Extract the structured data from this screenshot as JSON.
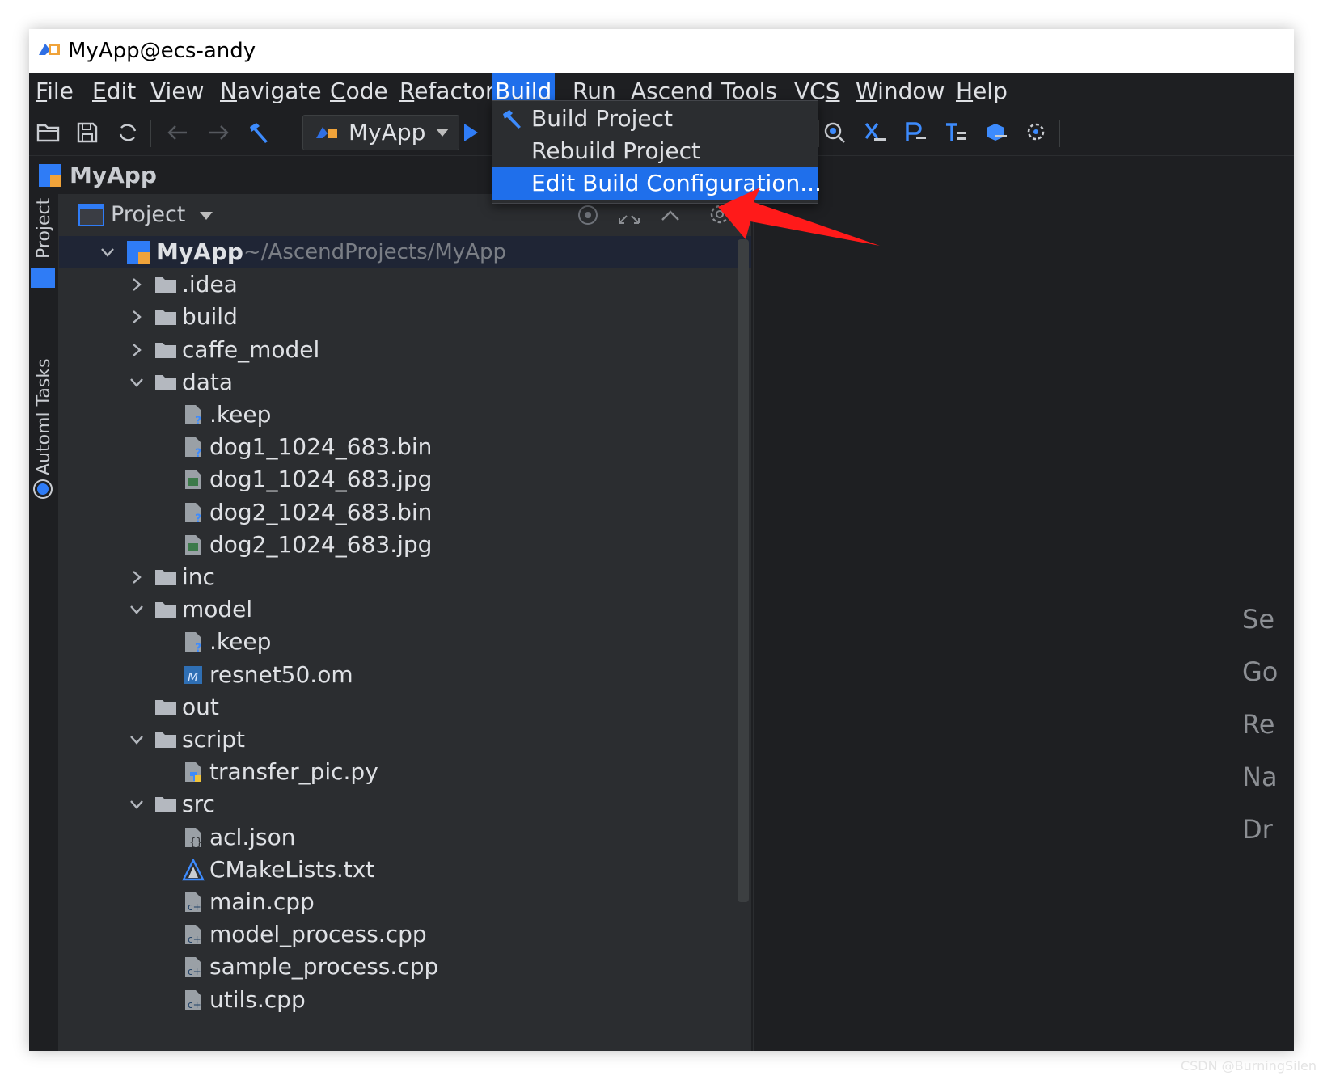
{
  "window": {
    "title": "MyApp@ecs-andy"
  },
  "menubar": {
    "items": [
      {
        "label": "File",
        "key": "F",
        "rest": "ile"
      },
      {
        "label": "Edit",
        "key": "E",
        "rest": "dit"
      },
      {
        "label": "View",
        "key": "V",
        "rest": "iew"
      },
      {
        "label": "Navigate",
        "key": "N",
        "rest": "avigate"
      },
      {
        "label": "Code",
        "key": "C",
        "rest": "ode"
      },
      {
        "label": "Refactor",
        "key": "R",
        "rest": "efactor"
      },
      {
        "label": "Build",
        "key": "B",
        "rest": "uild"
      },
      {
        "label": "Run",
        "pre": "R",
        "key": "u",
        "rest": "n"
      },
      {
        "label": "Ascend",
        "key": "A",
        "rest": "scend"
      },
      {
        "label": "Tools",
        "key": "T",
        "rest": "ools"
      },
      {
        "label": "VCS",
        "pre": "VC",
        "key": "S",
        "rest": ""
      },
      {
        "label": "Window",
        "key": "W",
        "rest": "indow"
      },
      {
        "label": "Help",
        "key": "H",
        "rest": "elp"
      }
    ],
    "active": "Build"
  },
  "toolbar": {
    "run_config": "MyApp",
    "icons": [
      "open-folder-icon",
      "save-icon",
      "sync-icon",
      "back-icon",
      "forward-icon",
      "build-hammer-icon",
      "run-icon",
      "search-model-icon",
      "tool-x-icon",
      "tool-p-icon",
      "tool-t-icon",
      "tool-box-icon",
      "tool-gear-icon"
    ]
  },
  "breadcrumb": {
    "label": "MyApp"
  },
  "side_stripe": {
    "project_tab": "Project",
    "tasks_tab": "Automl Tasks"
  },
  "project_panel": {
    "title": "Project",
    "root": {
      "name": "MyApp",
      "path": "~/AscendProjects/MyApp"
    },
    "nodes": [
      {
        "name": ".idea",
        "type": "folder",
        "depth": 1,
        "state": "collapsed"
      },
      {
        "name": "build",
        "type": "folder",
        "depth": 1,
        "state": "collapsed"
      },
      {
        "name": "caffe_model",
        "type": "folder",
        "depth": 1,
        "state": "collapsed"
      },
      {
        "name": "data",
        "type": "folder",
        "depth": 1,
        "state": "expanded"
      },
      {
        "name": ".keep",
        "type": "unknown-file",
        "depth": 2
      },
      {
        "name": "dog1_1024_683.bin",
        "type": "unknown-file",
        "depth": 2
      },
      {
        "name": "dog1_1024_683.jpg",
        "type": "image-file",
        "depth": 2
      },
      {
        "name": "dog2_1024_683.bin",
        "type": "unknown-file",
        "depth": 2
      },
      {
        "name": "dog2_1024_683.jpg",
        "type": "image-file",
        "depth": 2
      },
      {
        "name": "inc",
        "type": "folder",
        "depth": 1,
        "state": "collapsed"
      },
      {
        "name": "model",
        "type": "folder",
        "depth": 1,
        "state": "expanded"
      },
      {
        "name": ".keep",
        "type": "unknown-file",
        "depth": 2
      },
      {
        "name": "resnet50.om",
        "type": "model-file",
        "depth": 2
      },
      {
        "name": "out",
        "type": "folder",
        "depth": 1,
        "state": "none"
      },
      {
        "name": "script",
        "type": "folder",
        "depth": 1,
        "state": "expanded"
      },
      {
        "name": "transfer_pic.py",
        "type": "python-file",
        "depth": 2
      },
      {
        "name": "src",
        "type": "folder",
        "depth": 1,
        "state": "expanded"
      },
      {
        "name": "acl.json",
        "type": "json-file",
        "depth": 2
      },
      {
        "name": "CMakeLists.txt",
        "type": "cmake-file",
        "depth": 2
      },
      {
        "name": "main.cpp",
        "type": "cpp-file",
        "depth": 2
      },
      {
        "name": "model_process.cpp",
        "type": "cpp-file",
        "depth": 2
      },
      {
        "name": "sample_process.cpp",
        "type": "cpp-file",
        "depth": 2
      },
      {
        "name": "utils.cpp",
        "type": "cpp-file",
        "depth": 2
      }
    ]
  },
  "build_menu": {
    "items": [
      {
        "label": "Build Project",
        "icon": "hammer-icon"
      },
      {
        "label": "Rebuild Project",
        "icon": ""
      },
      {
        "label": "Edit Build Configuration...",
        "icon": "",
        "highlighted": true
      }
    ]
  },
  "editor_hints": [
    "Se",
    "Go",
    "Re",
    "Na",
    "Dr"
  ],
  "watermark": "CSDN @BurningSilen",
  "colors": {
    "accent": "#1f6feb",
    "annotation_arrow": "#ff1a1a",
    "background": "#1e1f22",
    "panel": "#2b2d30"
  }
}
